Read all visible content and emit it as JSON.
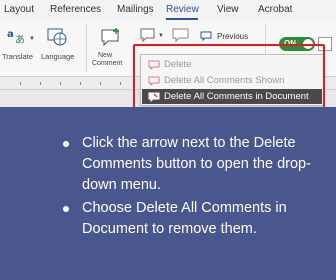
{
  "tabs": [
    {
      "label": "Layout",
      "active": false
    },
    {
      "label": "References",
      "active": false
    },
    {
      "label": "Mailings",
      "active": false
    },
    {
      "label": "Review",
      "active": true
    },
    {
      "label": "View",
      "active": false
    },
    {
      "label": "Acrobat",
      "active": false
    }
  ],
  "ribbon": {
    "translate_label": "Translate",
    "language_label": "Language",
    "new_comment_line1": "New",
    "new_comment_line2": "Comment",
    "previous_label": "Previous",
    "toggle_label": "ON"
  },
  "delete_menu": {
    "items": [
      {
        "label": "Delete",
        "highlighted": false
      },
      {
        "label": "Delete All Comments Shown",
        "highlighted": false
      },
      {
        "label": "Delete All Comments in Document",
        "highlighted": true
      }
    ]
  },
  "instructions": [
    "Click the arrow next to the Delete Comments button to open the drop-down menu.",
    "Choose Delete All Comments in Document to remove them."
  ],
  "colors": {
    "background": "#4a568e",
    "accent": "#2b579a",
    "callout": "#e21b1b",
    "toggle_on": "#2e8b3e"
  }
}
